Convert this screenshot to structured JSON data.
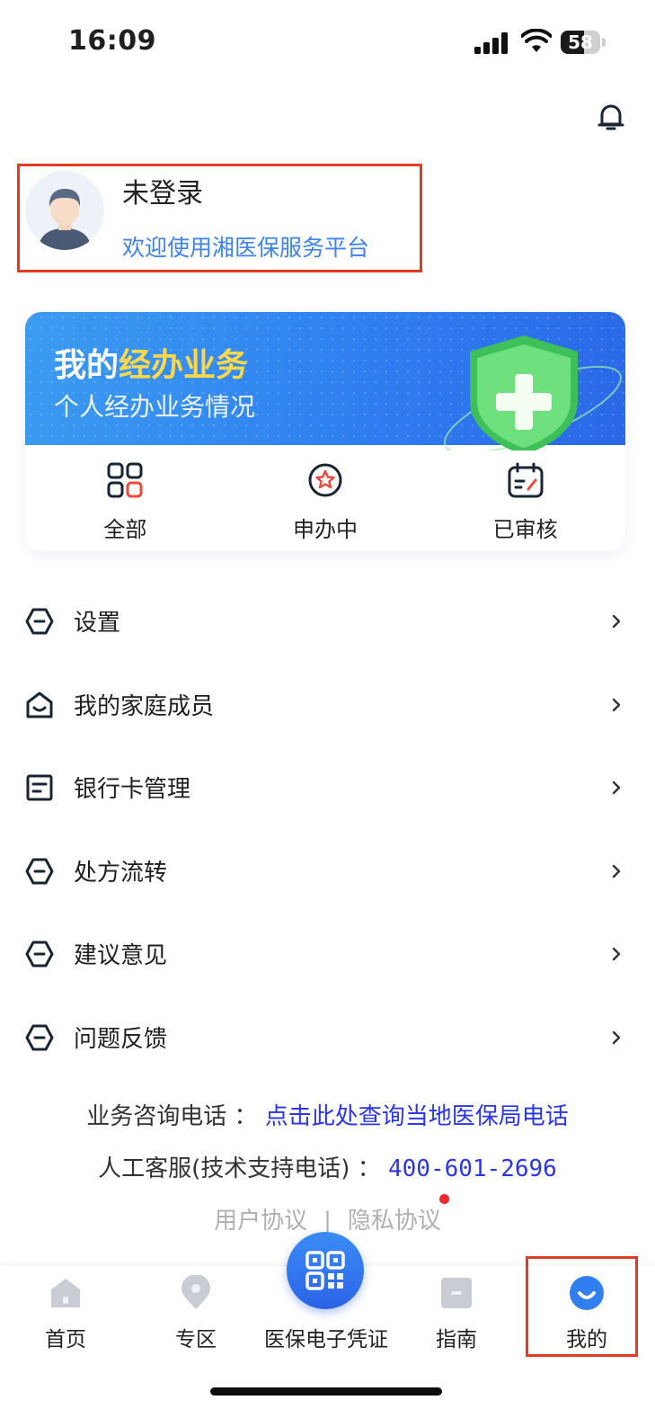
{
  "status_bar": {
    "time": "16:09",
    "battery_level": "58",
    "battery_fraction": 0.58
  },
  "profile": {
    "name": "未登录",
    "welcome": "欢迎使用湘医保服务平台"
  },
  "business": {
    "title_prefix": "我的",
    "title_highlight": "经办业务",
    "subtitle": "个人经办业务情况",
    "items": [
      {
        "label": "全部",
        "icon": "grid-icon"
      },
      {
        "label": "申办中",
        "icon": "star-circle-icon"
      },
      {
        "label": "已审核",
        "icon": "calendar-check-icon"
      }
    ]
  },
  "menu": [
    {
      "label": "设置",
      "icon": "hexagon-icon"
    },
    {
      "label": "我的家庭成员",
      "icon": "family-home-icon"
    },
    {
      "label": "银行卡管理",
      "icon": "card-icon"
    },
    {
      "label": "处方流转",
      "icon": "hexagon-icon"
    },
    {
      "label": "建议意见",
      "icon": "hexagon-icon"
    },
    {
      "label": "问题反馈",
      "icon": "hexagon-icon"
    }
  ],
  "contact": {
    "consult_label": "业务咨询电话",
    "colon": "：",
    "consult_link": "点击此处查询当地医保局电话",
    "support_label": "人工客服(技术支持电话)",
    "support_phone": "400-601-2696"
  },
  "agreements": {
    "user": "用户协议",
    "separator": "|",
    "privacy": "隐私协议"
  },
  "tabbar": {
    "tabs": [
      {
        "label": "首页",
        "icon": "home-icon"
      },
      {
        "label": "专区",
        "icon": "location-icon"
      },
      {
        "label": "医保电子凭证",
        "icon": "qr-code-icon"
      },
      {
        "label": "指南",
        "icon": "guide-icon"
      },
      {
        "label": "我的",
        "icon": "smile-icon"
      }
    ],
    "active_color": "#2f7ff0"
  }
}
